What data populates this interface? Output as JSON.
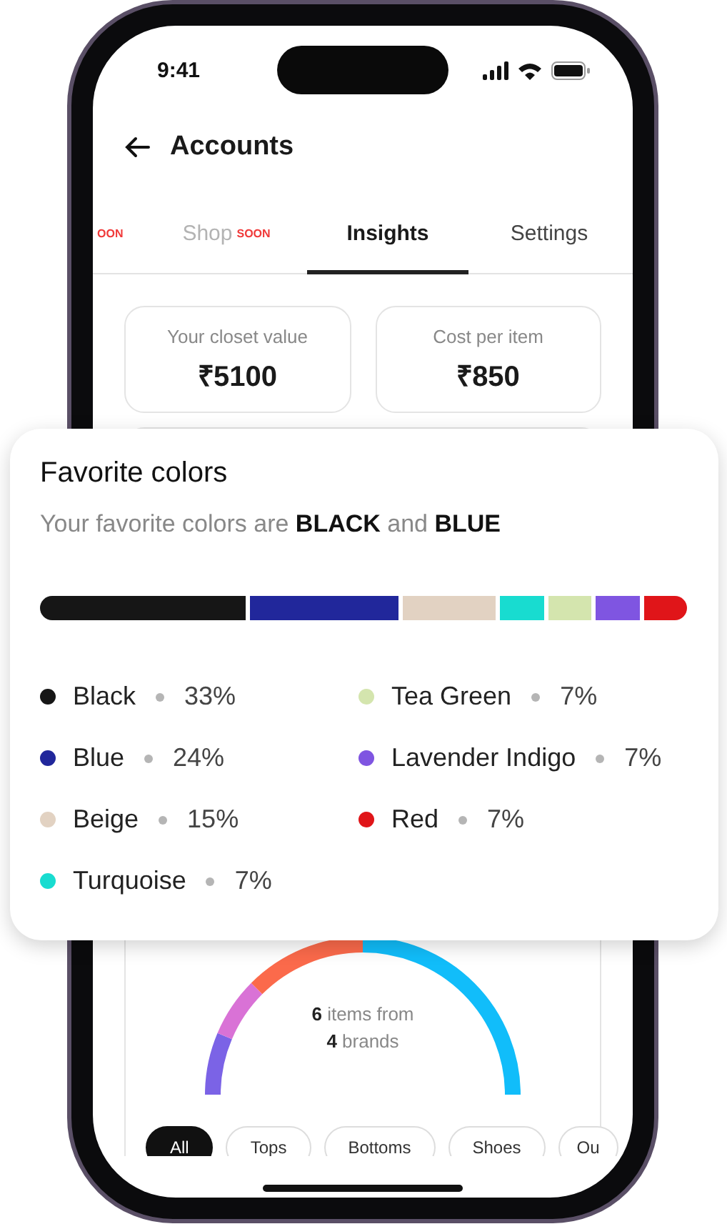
{
  "status_bar": {
    "time": "9:41"
  },
  "header": {
    "title": "Accounts"
  },
  "tabs": [
    {
      "badge": "OON",
      "selected": false
    },
    {
      "label": "Shop",
      "badge": "SOON",
      "selected": false,
      "disabled": true
    },
    {
      "label": "Insights",
      "selected": true,
      "disabled": false
    },
    {
      "label": "Settings",
      "selected": false,
      "disabled": false
    }
  ],
  "stats": [
    {
      "label": "Your closet value",
      "value": "₹5100"
    },
    {
      "label": "Cost per item",
      "value": "₹850"
    }
  ],
  "brands_card": {
    "summary": [
      "**6** items from",
      "**4** brands"
    ],
    "filters": [
      {
        "label": "All",
        "selected": true
      },
      {
        "label": "Tops",
        "selected": false
      },
      {
        "label": "Bottoms",
        "selected": false
      },
      {
        "label": "Shoes",
        "selected": false
      },
      {
        "label": "Ou",
        "selected": false
      }
    ]
  },
  "favorite_colors": {
    "title": "Favorite colors",
    "subtitle": "Your favorite colors are **BLACK** and **BLUE**",
    "colors": [
      {
        "name": "Black",
        "percent": "33%",
        "color": "#161616"
      },
      {
        "name": "Blue",
        "percent": "24%",
        "color": "#21279b"
      },
      {
        "name": "Beige",
        "percent": "15%",
        "color": "#e2d2c2"
      },
      {
        "name": "Turquoise",
        "percent": "7%",
        "color": "#18dcd0"
      },
      {
        "name": "Tea Green",
        "percent": "7%",
        "color": "#d4e5ae"
      },
      {
        "name": "Lavender Indigo",
        "percent": "7%",
        "color": "#7f55e1"
      },
      {
        "name": "Red",
        "percent": "7%",
        "color": "#e01519"
      }
    ]
  }
}
